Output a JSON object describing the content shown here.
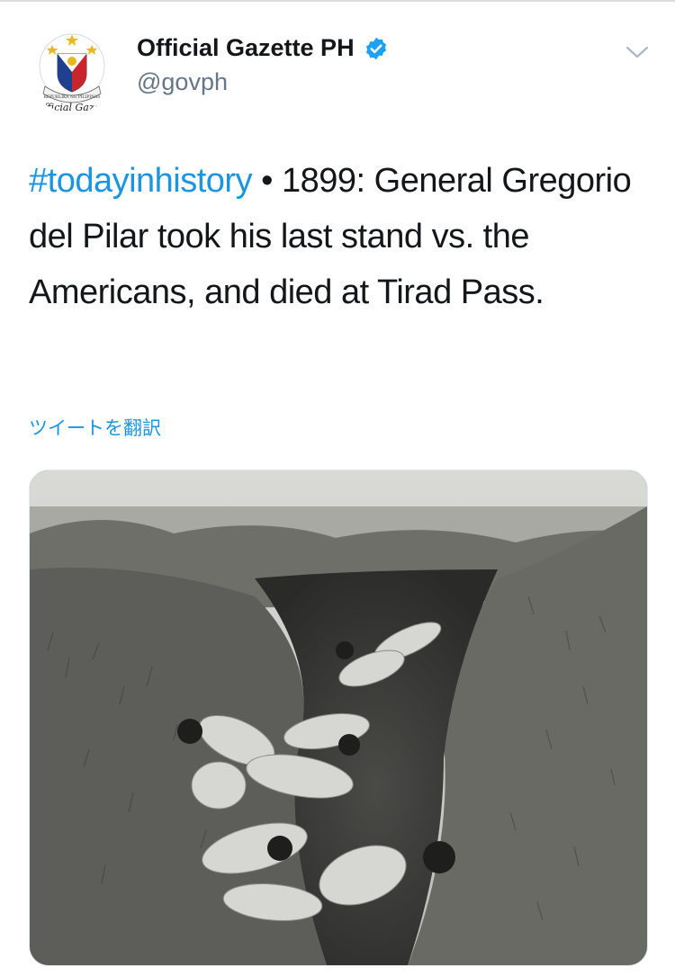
{
  "account": {
    "display_name": "Official Gazette PH",
    "handle": "@govph",
    "verified": true,
    "avatar_icon": "philippine-seal-icon",
    "avatar_seal_text": "REPUBLIKA NG PILIPINAS",
    "avatar_caption": "fficial Gaze"
  },
  "tweet": {
    "hashtag": "#todayinhistory",
    "text": " • 1899: General Gregorio del Pilar took his last stand vs. the Americans, and died at Tirad Pass.",
    "translate_label": "ツイートを翻訳"
  },
  "colors": {
    "link": "#1b95e0",
    "text": "#14171a",
    "secondary": "#657786",
    "verified_badge": "#1da1f2"
  },
  "icons": {
    "verified": "verified-badge-icon",
    "menu": "chevron-down-icon"
  }
}
